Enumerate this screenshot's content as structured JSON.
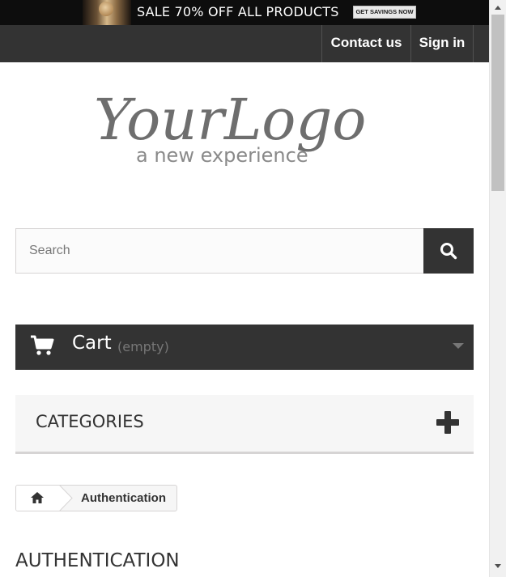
{
  "banner": {
    "text": "SALE 70% OFF ALL PRODUCTS",
    "button_label": "GET SAVINGS NOW"
  },
  "nav": {
    "contact_label": "Contact us",
    "signin_label": "Sign in"
  },
  "logo": {
    "wordmark": "YourLogo",
    "tagline": "a new experience"
  },
  "search": {
    "placeholder": "Search",
    "value": "",
    "button_icon": "search-icon"
  },
  "cart": {
    "label": "Cart",
    "status": "(empty)",
    "icon": "cart-icon",
    "toggle_icon": "caret-down-icon"
  },
  "categories": {
    "label": "CATEGORIES",
    "toggle_icon": "plus-icon"
  },
  "breadcrumb": {
    "home_icon": "home-icon",
    "current": "Authentication"
  },
  "page": {
    "heading": "AUTHENTICATION"
  },
  "colors": {
    "dark": "#333333",
    "banner_bg": "#0d0d0d",
    "light_panel": "#f6f6f6",
    "border": "#d6d4d4",
    "muted_text": "#777777"
  }
}
